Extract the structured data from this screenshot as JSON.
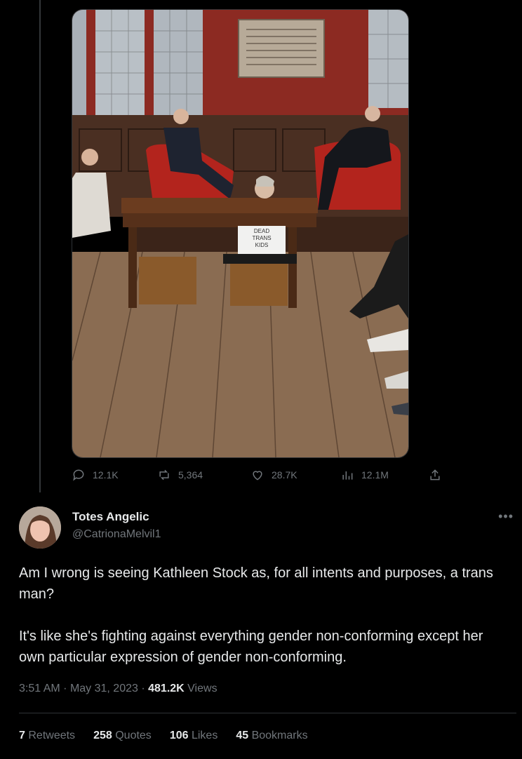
{
  "media": {
    "sign_text": [
      "DEAD",
      "TRANS",
      "KIDS"
    ]
  },
  "actions": {
    "replies": "12.1K",
    "retweets": "5,364",
    "likes": "28.7K",
    "views": "12.1M"
  },
  "author": {
    "name": "Totes Angelic",
    "handle": "@CatrionaMelvil1"
  },
  "tweet": {
    "paragraphs": [
      "Am I wrong is seeing Kathleen Stock as, for all intents and purposes, a trans man?",
      "It's like she's fighting against everything gender non-conforming except her own particular expression of gender non-conforming."
    ],
    "time": "3:51 AM",
    "date": "May 31, 2023",
    "views_count": "481.2K",
    "views_label": "Views"
  },
  "stats": {
    "retweets_count": "7",
    "retweets_label": "Retweets",
    "quotes_count": "258",
    "quotes_label": "Quotes",
    "likes_count": "106",
    "likes_label": "Likes",
    "bookmarks_count": "45",
    "bookmarks_label": "Bookmarks"
  },
  "colors": {
    "background": "#000000",
    "text": "#e7e9ea",
    "muted": "#71767b",
    "border": "#2f3336"
  },
  "icons": [
    "reply-icon",
    "retweet-icon",
    "like-icon",
    "views-icon",
    "share-icon",
    "more-icon"
  ]
}
